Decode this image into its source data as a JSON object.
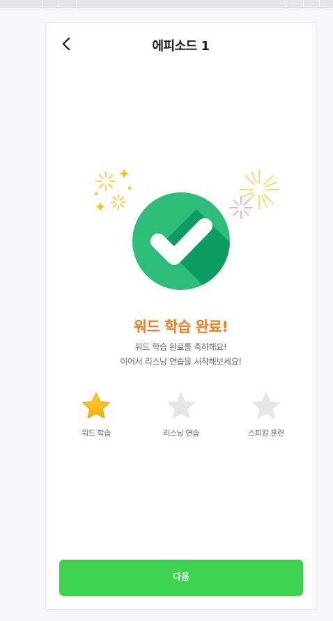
{
  "header": {
    "back_icon": "chevron-left-icon",
    "title": "에피소드 1"
  },
  "result": {
    "headline": "워드 학습 완료!",
    "message_line1": "워드 학습 완료를 축하해요!",
    "message_line2": "이어서 리스닝 연습을 시작해보세요!",
    "icon": "check-circle-icon",
    "decorations": [
      "fireworks-icon"
    ]
  },
  "steps": [
    {
      "label": "워드 학습",
      "completed": true,
      "icon": "star-icon"
    },
    {
      "label": "리스닝 연습",
      "completed": false,
      "icon": "star-icon"
    },
    {
      "label": "스피킹 훈련",
      "completed": false,
      "icon": "star-icon"
    }
  ],
  "footer": {
    "next_label": "다음"
  },
  "colors": {
    "accent_green": "#3fd24f",
    "check_green": "#2ebd78",
    "headline_orange": "#f27b20",
    "star_active": "#ffc21a",
    "star_inactive": "#e6e6e6"
  }
}
